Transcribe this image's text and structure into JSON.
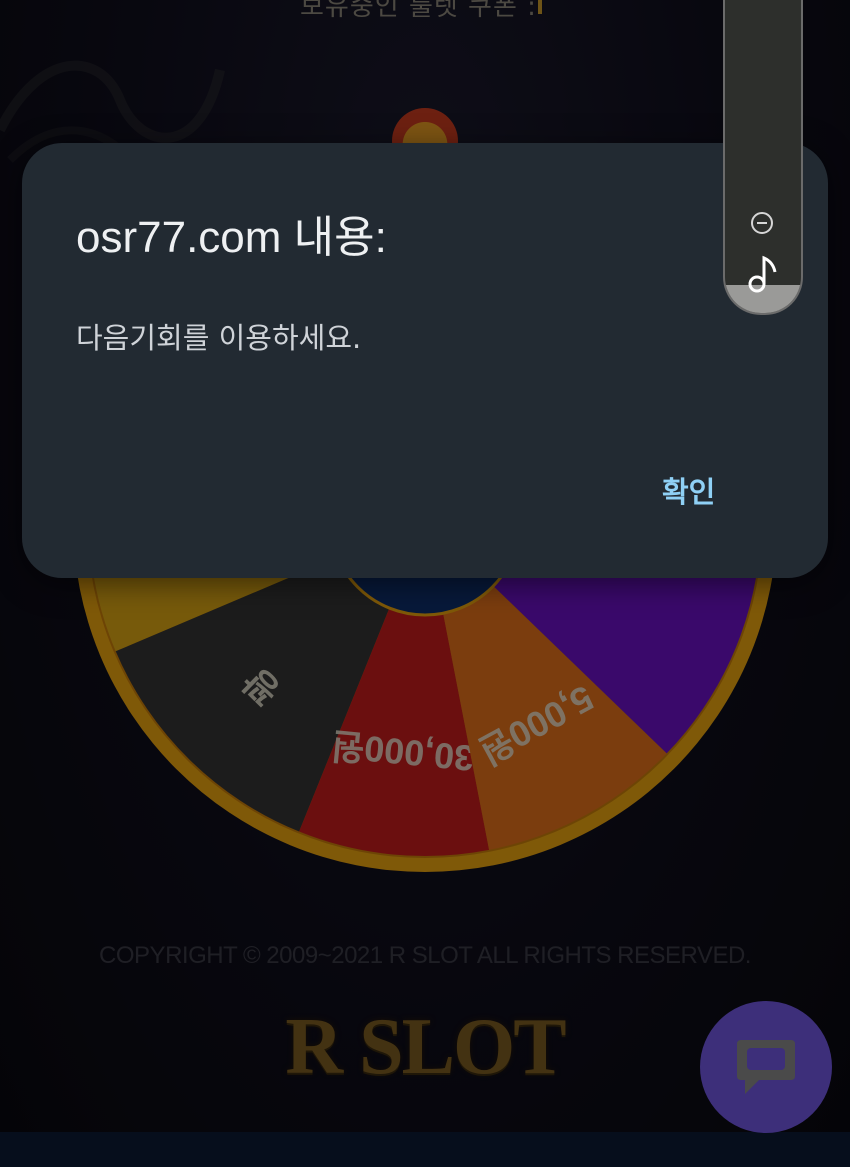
{
  "page": {
    "top_text": "보유중인 룰렛 쿠폰 :",
    "copyright": "COPYRIGHT © 2009~2021 R SLOT ALL RIGHTS RESERVED.",
    "logo_text": "R SLOT"
  },
  "wheel": {
    "segments": [
      {
        "label": "5,000원",
        "color": "#d9a514"
      },
      {
        "label": "꽝",
        "color": "#343434"
      },
      {
        "label": "30,000원",
        "color": "#c41d1d"
      },
      {
        "label": "5,000원",
        "color": "#e06f1a"
      },
      {
        "label": "",
        "color": "#6a12c4"
      }
    ],
    "rim_color": "#e8a20f",
    "hub_color": "#0d2f6b"
  },
  "dialog": {
    "title": "osr77.com 내용:",
    "message": "다음기회를 이용하세요.",
    "ok_label": "확인"
  },
  "volume_panel": {
    "level": 0.08,
    "icons": [
      "minus-circle-icon",
      "music-note-icon"
    ]
  },
  "chat_button": {
    "icon": "chat-bubble-icon",
    "color": "#3d2f7a"
  }
}
